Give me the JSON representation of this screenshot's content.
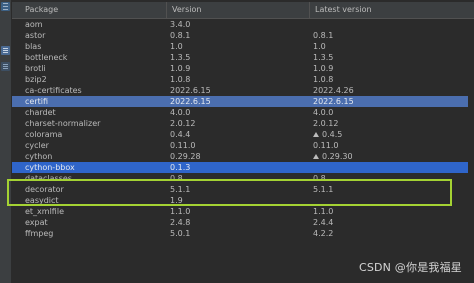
{
  "table": {
    "headers": {
      "package": "Package",
      "version": "Version",
      "latest": "Latest version"
    },
    "rows": [
      {
        "name": "aom",
        "version": "3.4.0",
        "latest": "",
        "upgrade": false,
        "selected": false
      },
      {
        "name": "astor",
        "version": "0.8.1",
        "latest": "0.8.1",
        "upgrade": false,
        "selected": false
      },
      {
        "name": "blas",
        "version": "1.0",
        "latest": "1.0",
        "upgrade": false,
        "selected": false
      },
      {
        "name": "bottleneck",
        "version": "1.3.5",
        "latest": "1.3.5",
        "upgrade": false,
        "selected": false
      },
      {
        "name": "brotli",
        "version": "1.0.9",
        "latest": "1.0.9",
        "upgrade": false,
        "selected": false
      },
      {
        "name": "bzip2",
        "version": "1.0.8",
        "latest": "1.0.8",
        "upgrade": false,
        "selected": false
      },
      {
        "name": "ca-certificates",
        "version": "2022.6.15",
        "latest": "2022.4.26",
        "upgrade": false,
        "selected": false
      },
      {
        "name": "certifi",
        "version": "2022.6.15",
        "latest": "2022.6.15",
        "upgrade": false,
        "selected": true
      },
      {
        "name": "chardet",
        "version": "4.0.0",
        "latest": "4.0.0",
        "upgrade": false,
        "selected": false
      },
      {
        "name": "charset-normalizer",
        "version": "2.0.12",
        "latest": "2.0.12",
        "upgrade": false,
        "selected": false
      },
      {
        "name": "colorama",
        "version": "0.4.4",
        "latest": "0.4.5",
        "upgrade": true,
        "selected": false
      },
      {
        "name": "cycler",
        "version": "0.11.0",
        "latest": "0.11.0",
        "upgrade": false,
        "selected": false
      },
      {
        "name": "cython",
        "version": "0.29.28",
        "latest": "0.29.30",
        "upgrade": true,
        "selected": false
      },
      {
        "name": "cython-bbox",
        "version": "0.1.3",
        "latest": "",
        "upgrade": false,
        "selected": true
      },
      {
        "name": "dataclasses",
        "version": "0.8",
        "latest": "0.8",
        "upgrade": false,
        "selected": false
      },
      {
        "name": "decorator",
        "version": "5.1.1",
        "latest": "5.1.1",
        "upgrade": false,
        "selected": false
      },
      {
        "name": "easydict",
        "version": "1.9",
        "latest": "",
        "upgrade": false,
        "selected": false
      },
      {
        "name": "et_xmlfile",
        "version": "1.1.0",
        "latest": "1.1.0",
        "upgrade": false,
        "selected": false
      },
      {
        "name": "expat",
        "version": "2.4.8",
        "latest": "2.4.4",
        "upgrade": false,
        "selected": false
      },
      {
        "name": "ffmpeg",
        "version": "5.0.1",
        "latest": "4.2.2",
        "upgrade": false,
        "selected": false
      }
    ]
  },
  "watermark": "CSDN @你是我福星",
  "colors": {
    "background": "#2b2b2b",
    "header": "#3c3f41",
    "selection": "#2f65ca",
    "highlight_box": "#a4d233"
  },
  "icons": {
    "toolbar": [
      "list-icon",
      "list-icon",
      "list-icon"
    ],
    "upgrade": "triangle-up-icon"
  }
}
